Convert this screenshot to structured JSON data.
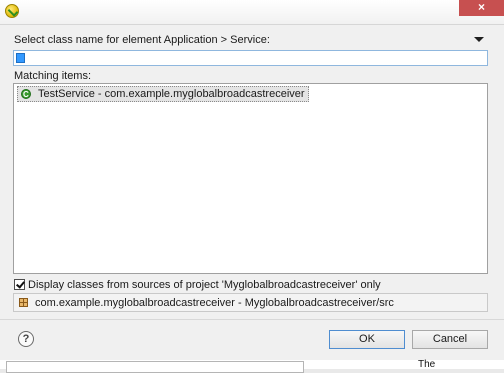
{
  "window": {
    "close_glyph": "×"
  },
  "dialog": {
    "prompt": "Select class name for element Application > Service:",
    "filter_value": "**",
    "matching_label": "Matching items:",
    "results": [
      {
        "label": "TestService - com.example.myglobalbroadcastreceiver",
        "icon": "class-icon"
      }
    ],
    "filter_checkbox": {
      "checked": true,
      "label": "Display classes from sources of project 'Myglobalbroadcastreceiver' only"
    },
    "package_location": "com.example.myglobalbroadcastreceiver - Myglobalbroadcastreceiver/src",
    "buttons": {
      "help_glyph": "?",
      "ok": "OK",
      "cancel": "Cancel"
    }
  },
  "background_window": {
    "partial_text": "The"
  },
  "colors": {
    "close_button": "#c75050",
    "selection_accent": "#3399ff",
    "class_icon": "#3a9b2e"
  }
}
